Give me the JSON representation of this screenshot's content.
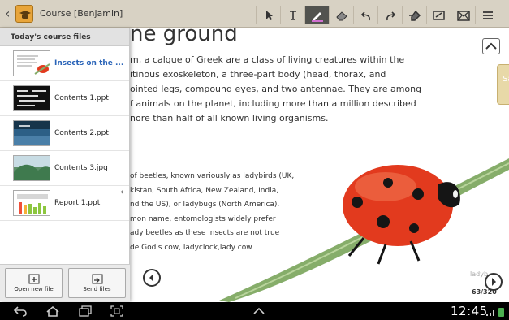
{
  "header": {
    "course_title": "Course [Benjamin]",
    "tools": [
      "pointer-icon",
      "text-cursor-icon",
      "pen-icon",
      "eraser-icon",
      "undo-icon",
      "redo-icon",
      "hand-pen-icon",
      "edit-box-icon",
      "mail-icon",
      "menu-icon"
    ],
    "active_tool": "pen-icon"
  },
  "document": {
    "heading_fragment": "ne ground",
    "paragraph1": [
      "m, a calque of Greek are a class of living creatures within the",
      "itinous exoskeleton, a three-part body (head, thorax, and",
      "ointed legs, compound eyes, and two antennae. They are among",
      "f animals on the planet, including more than a million described",
      "nore than half of all known living organisms."
    ],
    "paragraph2": [
      "of beetles, known variously as ladybirds (UK,",
      "kistan, South Africa, New Zealand, India,",
      "nd the US), or ladybugs (North America).",
      "mon name, entomologists widely prefer",
      "ady beetles as these insects are not true",
      "de God's cow, ladyclock,lady cow"
    ],
    "side_tab_text": "Sa",
    "corner_label": "ladyb",
    "page_count": "63/320"
  },
  "panel": {
    "title": "Today's course files",
    "files": [
      {
        "name": "Insects on the ...",
        "selected": true
      },
      {
        "name": "Contents 1.ppt",
        "selected": false
      },
      {
        "name": "Contents 2.ppt",
        "selected": false
      },
      {
        "name": "Contents 3.jpg",
        "selected": false
      },
      {
        "name": "Report 1.ppt",
        "selected": false
      }
    ],
    "open_new_file_label": "Open new file",
    "send_files_label": "Send files"
  },
  "status_bar": {
    "time": "12:45"
  },
  "colors": {
    "header_bg": "#d8d2c4",
    "active_tool_bg": "#52534f",
    "accent_blue": "#2a64b8",
    "ladybug_red": "#e23a1e",
    "leaf_green": "#7fa860"
  }
}
